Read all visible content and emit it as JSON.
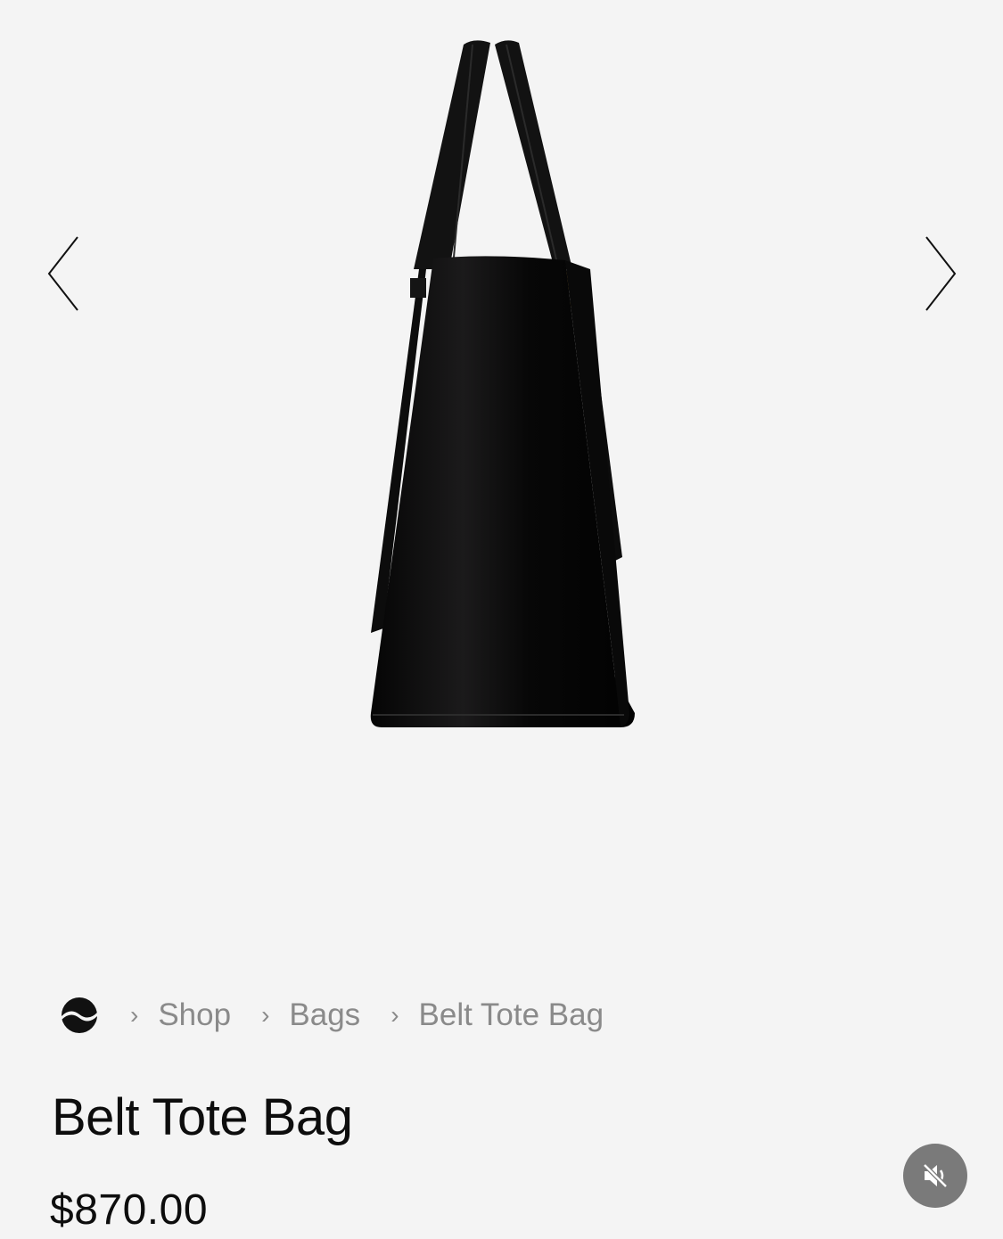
{
  "gallery": {
    "image_icon": "tote-bag-side-view",
    "prev_icon": "chevron-left-icon",
    "next_icon": "chevron-right-icon"
  },
  "breadcrumb": {
    "home_icon": "brand-logo-icon",
    "separator": "›",
    "items": [
      {
        "label": "Shop"
      },
      {
        "label": "Bags"
      }
    ],
    "current": "Belt Tote Bag"
  },
  "product": {
    "title": "Belt Tote Bag",
    "price": "$870.00"
  },
  "media": {
    "mute_icon": "speaker-muted-icon"
  },
  "colors": {
    "background": "#f4f4f4",
    "text": "#0d0d0d",
    "muted_text": "#8a8a8a",
    "mute_button": "#7a7a7a"
  }
}
